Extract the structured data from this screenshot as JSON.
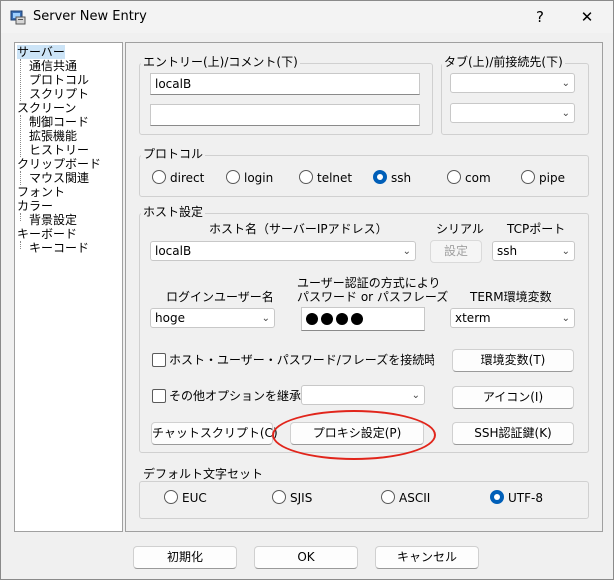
{
  "window": {
    "title": "Server New Entry",
    "help_label": "?",
    "close_label": "✕",
    "colors": {
      "accent": "#005fb8",
      "highlight": "#e1251b",
      "selection": "#cce4f7"
    }
  },
  "sidebar": {
    "items": [
      {
        "label": "サーバー"
      },
      {
        "label": "通信共通"
      },
      {
        "label": "プロトコル"
      },
      {
        "label": "スクリプト"
      },
      {
        "label": "スクリーン"
      },
      {
        "label": "制御コード"
      },
      {
        "label": "拡張機能"
      },
      {
        "label": "ヒストリー"
      },
      {
        "label": "クリップボード"
      },
      {
        "label": "マウス関連"
      },
      {
        "label": "フォント"
      },
      {
        "label": "カラー"
      },
      {
        "label": "背景設定"
      },
      {
        "label": "キーボード"
      },
      {
        "label": "キーコード"
      }
    ]
  },
  "entry": {
    "label": "エントリー(上)/コメント(下)",
    "entry_value": "localB",
    "comment_value": ""
  },
  "tab": {
    "label": "タブ(上)/前接続先(下)",
    "tab_value": "",
    "prev_value": ""
  },
  "protocol": {
    "label": "プロトコル",
    "options": [
      {
        "label": "direct"
      },
      {
        "label": "login"
      },
      {
        "label": "telnet"
      },
      {
        "label": "ssh"
      },
      {
        "label": "com"
      },
      {
        "label": "pipe"
      }
    ],
    "selected": "ssh"
  },
  "host": {
    "group_label": "ホスト設定",
    "hostname_label": "ホスト名（サーバーIPアドレス）",
    "hostname_value": "localB",
    "serial_label": "シリアル",
    "serial_button": "設定",
    "tcp_label": "TCPポート",
    "tcp_value": "ssh",
    "login_user_label": "ログインユーザー名",
    "login_user_value": "hoge",
    "auth_label_line1": "ユーザー認証の方式により",
    "auth_label_line2": "パスワード or パスフレーズ",
    "term_label": "TERM環境変数",
    "term_value": "xterm",
    "checkbox_host_user_label": "ホスト・ユーザー・パスワード/フレーズを接続時に入力",
    "env_button": "環境変数(T)",
    "checkbox_inherit_label": "その他オプションを継承",
    "inherit_value": "",
    "icon_button": "アイコン(I)",
    "chat_script_button": "チャットスクリプト(C)",
    "proxy_button": "プロキシ設定(P)",
    "ssh_key_button": "SSH認証鍵(K)"
  },
  "charset": {
    "label": "デフォルト文字セット",
    "options": [
      {
        "label": "EUC"
      },
      {
        "label": "SJIS"
      },
      {
        "label": "ASCII"
      },
      {
        "label": "UTF-8"
      }
    ],
    "selected": "UTF-8"
  },
  "footer": {
    "reset_button": "初期化",
    "ok_button": "OK",
    "cancel_button": "キャンセル"
  }
}
